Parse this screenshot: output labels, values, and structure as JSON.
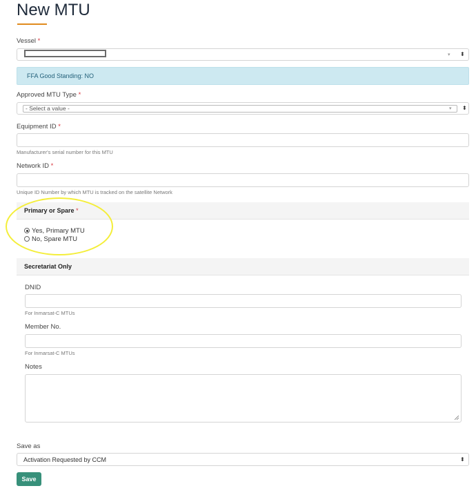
{
  "page": {
    "title": "New MTU"
  },
  "vessel": {
    "label": "Vessel",
    "required": "*"
  },
  "standing_alert": {
    "text": "FFA Good Standing: NO"
  },
  "mtu_type": {
    "label": "Approved MTU Type",
    "required": "*",
    "value": "- Select a value -"
  },
  "equipment_id": {
    "label": "Equipment ID",
    "required": "*",
    "value": "",
    "help": "Manufacturer's serial number for this MTU"
  },
  "network_id": {
    "label": "Network ID",
    "required": "*",
    "value": "",
    "help": "Unique ID Number by which MTU is tracked on the satellite Network"
  },
  "primary_or_spare": {
    "label": "Primary or Spare",
    "required": "*",
    "options": [
      {
        "label": "Yes, Primary MTU",
        "checked": true
      },
      {
        "label": "No, Spare MTU",
        "checked": false
      }
    ]
  },
  "secretariat": {
    "heading": "Secretariat Only",
    "dnid": {
      "label": "DNID",
      "value": "",
      "help": "For Inmarsat-C MTUs"
    },
    "member_no": {
      "label": "Member No.",
      "value": "",
      "help": "For Inmarsat-C MTUs"
    },
    "notes": {
      "label": "Notes",
      "value": ""
    }
  },
  "save_as": {
    "label": "Save as",
    "value": "Activation Requested by CCM"
  },
  "actions": {
    "save_label": "Save"
  },
  "colors": {
    "accent": "#e08a1e",
    "save_button": "#37907a",
    "alert_bg": "#cde9f1",
    "required": "#d9363e",
    "highlight": "#f4ee3a"
  }
}
